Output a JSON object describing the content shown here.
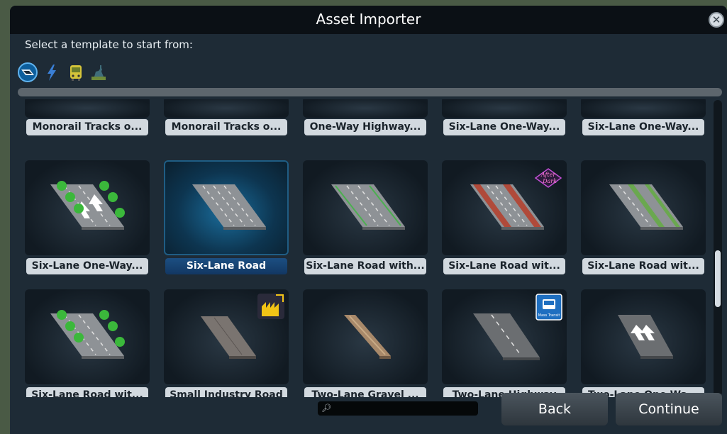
{
  "title": "Asset Importer",
  "prompt": "Select a template to start from:",
  "close_symbol": "✕",
  "categories": [
    {
      "icon": "roads-category-icon",
      "selected": true
    },
    {
      "icon": "lightning-category-icon",
      "selected": false
    },
    {
      "icon": "bus-category-icon",
      "selected": false
    },
    {
      "icon": "statue-category-icon",
      "selected": false
    }
  ],
  "rows": [
    [
      {
        "label": "Monorail Tracks o..."
      },
      {
        "label": "Monorail Tracks o..."
      },
      {
        "label": "One-Way Highway..."
      },
      {
        "label": "Six-Lane One-Way..."
      },
      {
        "label": "Six-Lane One-Way..."
      }
    ],
    [
      {
        "label": "Six-Lane One-Way...",
        "art": "trees-arrows"
      },
      {
        "label": "Six-Lane Road",
        "art": "plain",
        "selected": true
      },
      {
        "label": "Six-Lane Road with...",
        "art": "green-lines"
      },
      {
        "label": "Six-Lane Road wit...",
        "art": "red-lanes",
        "badge": "After Dark"
      },
      {
        "label": "Six-Lane Road wit...",
        "art": "green-median"
      }
    ],
    [
      {
        "label": "Six-Lane Road wit...",
        "art": "trees"
      },
      {
        "label": "Small Industry Road",
        "art": "industry",
        "badge": "industry-dlc"
      },
      {
        "label": "Two-Lane Gravel ...",
        "art": "gravel"
      },
      {
        "label": "Two-Lane Highway",
        "art": "highway",
        "badge": "Mass Transit"
      },
      {
        "label": "Two-Lane One-Wa...",
        "art": "oneway"
      }
    ]
  ],
  "search": {
    "placeholder": "",
    "value": ""
  },
  "buttons": {
    "back": "Back",
    "continue": "Continue"
  },
  "colors": {
    "accent": "#1c4f82",
    "label_bg": "#d2d9df",
    "dialog_bg": "#1e2b36"
  }
}
